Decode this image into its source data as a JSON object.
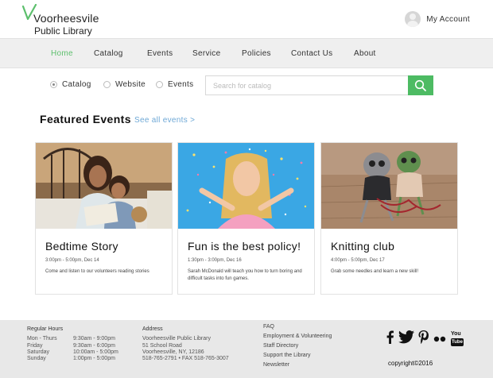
{
  "brand": {
    "line1": "Voorheesvile",
    "line2": "Public Library",
    "accent": "#5cbf6c"
  },
  "account": {
    "label": "My Account"
  },
  "nav": {
    "items": [
      {
        "label": "Home",
        "active": true
      },
      {
        "label": "Catalog"
      },
      {
        "label": "Events"
      },
      {
        "label": "Service"
      },
      {
        "label": "Policies"
      },
      {
        "label": "Contact Us"
      },
      {
        "label": "About"
      }
    ]
  },
  "search": {
    "options": [
      {
        "label": "Catalog",
        "checked": true
      },
      {
        "label": "Website",
        "checked": false
      },
      {
        "label": "Events",
        "checked": false
      }
    ],
    "placeholder": "Search for catalog",
    "button_color": "#4dbb63"
  },
  "featured": {
    "title": "Featured Events",
    "see_all": "See all events >",
    "cards": [
      {
        "title": "Bedtime Story",
        "date": "3:00pm - 5:00pm, Dec 14",
        "desc": "Come and listen to our volunteers reading stories"
      },
      {
        "title": "Fun is the best policy!",
        "date": "1:30pm - 3:00pm, Dec 16",
        "desc": "Sarah McDonald will teach you how to turn boring and difficult tasks into fun games."
      },
      {
        "title": "Knitting club",
        "date": "4:00pm - 5:00pm, Dec 17",
        "desc": "Grab some needles and learn a new skill!"
      }
    ]
  },
  "footer": {
    "hours_title": "Regular Hours",
    "hours": [
      {
        "day": "Mon - Thurs",
        "time": "9:30am - 9:00pm"
      },
      {
        "day": "Friday",
        "time": "9:30am - 6:00pm"
      },
      {
        "day": "Saturday",
        "time": "10:00am - 5:00pm"
      },
      {
        "day": "Sunday",
        "time": "1:00pm - 5:00pm"
      }
    ],
    "address_title": "Address",
    "address": [
      "Voorheesville Public Library",
      "51 School Road",
      "Voorheesville, NY, 12186",
      "518-765-2791 • FAX 518-765-3007"
    ],
    "links": [
      "FAQ",
      "Employment & Volunteering",
      "Staff Directory",
      "Support the Library",
      "Newsletter"
    ],
    "social_icons": [
      "facebook-icon",
      "twitter-icon",
      "pinterest-icon",
      "flickr-icon",
      "youtube-icon"
    ],
    "youtube_top": "You",
    "youtube_bottom": "Tube",
    "copyright": "copyright©2016"
  }
}
